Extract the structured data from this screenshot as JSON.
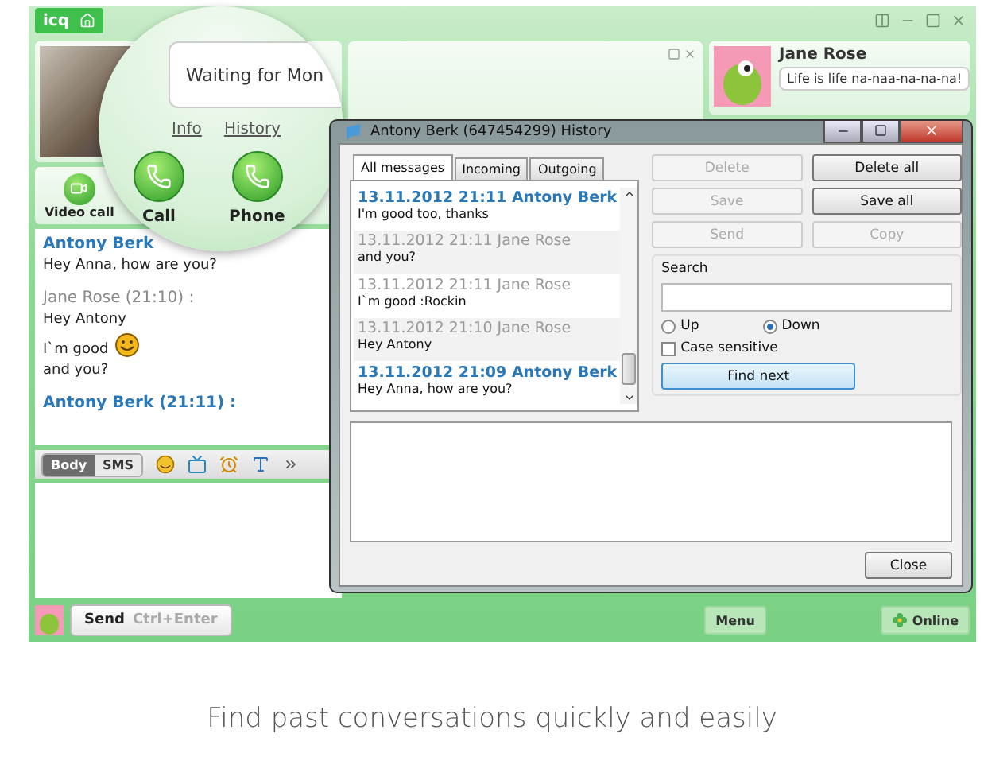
{
  "app": {
    "logo": "icq"
  },
  "contact": {
    "status_message": "Waiting for Mon",
    "links": [
      "Info",
      "History"
    ]
  },
  "call_buttons": [
    {
      "label": "Video call",
      "kind": "video"
    },
    {
      "label": "Call",
      "kind": "call"
    },
    {
      "label": "Phone",
      "kind": "phone"
    }
  ],
  "chat": {
    "messages": [
      {
        "author": "Antony Berk",
        "outgoing": true,
        "lines": [
          {
            "text": "Hey Anna, how are you?"
          }
        ]
      },
      {
        "author": "Jane Rose (21:10) :",
        "outgoing": false,
        "lines": [
          {
            "text": "Hey Antony"
          },
          {
            "text": "I`m good",
            "smiley": true
          },
          {
            "text": "and you?"
          }
        ]
      },
      {
        "author": "Antony Berk (21:11) :",
        "outgoing": true
      }
    ]
  },
  "composer": {
    "modes": [
      {
        "label": "Body",
        "selected": true
      },
      {
        "label": "SMS",
        "selected": false
      }
    ],
    "send": {
      "label": "Send",
      "shortcut": "Ctrl+Enter"
    }
  },
  "peer": {
    "name": "Jane Rose",
    "status": "Life is life na-naa-na-na-na!"
  },
  "history": {
    "title": "Antony Berk (647454299) History",
    "tabs": [
      {
        "label": "All messages",
        "selected": true
      },
      {
        "label": "Incoming",
        "selected": false
      },
      {
        "label": "Outgoing",
        "selected": false
      }
    ],
    "entries": [
      {
        "header": "13.11.2012 21:11 Antony Berk",
        "text": "I'm good too, thanks",
        "outgoing": true
      },
      {
        "header": "13.11.2012 21:11 Jane Rose",
        "text": "and you?",
        "outgoing": false
      },
      {
        "header": "13.11.2012 21:11 Jane Rose",
        "text": "I`m good :Rockin",
        "outgoing": false
      },
      {
        "header": "13.11.2012 21:10 Jane Rose",
        "text": "Hey Antony",
        "outgoing": false
      },
      {
        "header": "13.11.2012 21:09 Antony Berk",
        "text": "Hey Anna, how are you?",
        "outgoing": true
      }
    ],
    "actions": [
      {
        "label": "Delete",
        "disabled": true
      },
      {
        "label": "Delete all",
        "disabled": false
      },
      {
        "label": "Save",
        "disabled": true
      },
      {
        "label": "Save all",
        "disabled": false
      },
      {
        "label": "Send",
        "disabled": true
      },
      {
        "label": "Copy",
        "disabled": true
      }
    ],
    "search": {
      "label": "Search",
      "directions": [
        {
          "label": "Up",
          "selected": false
        },
        {
          "label": "Down",
          "selected": true
        }
      ],
      "case_sensitive": {
        "label": "Case sensitive",
        "checked": false
      },
      "find": "Find next"
    },
    "close": "Close"
  },
  "footer": {
    "menu": "Menu",
    "status": "Online"
  },
  "caption": "Find past conversations quickly and easily"
}
